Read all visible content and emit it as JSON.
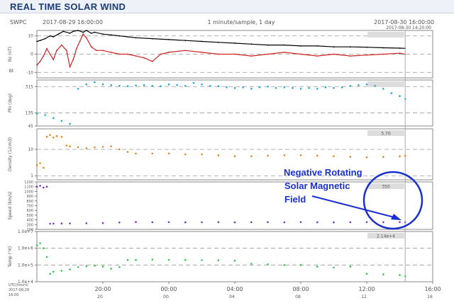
{
  "page": {
    "title": "REAL TIME SOLAR WIND"
  },
  "header": {
    "source": "SWPC",
    "start": "2017-08-29 16:00:00",
    "cadence": "1 minute/sample, 1 day",
    "end": "2017-08-30 16:00:00"
  },
  "cursor": {
    "time": "2017-08-30 14:20:00"
  },
  "annotation": {
    "lines": [
      "Negative Rotating",
      "Solar Magnetic",
      "Field"
    ],
    "color": "#1a2fd0"
  },
  "time_axis": {
    "label": "UTC(hours)",
    "date_label": "2017-08-29",
    "date_label2": "16:00",
    "ticks": [
      "20:00",
      "00:00",
      "04:00",
      "08:00",
      "12:00",
      "16:00"
    ],
    "tick_hours": [
      4,
      8,
      12,
      16,
      20,
      24
    ],
    "minor_ticks": [
      "20",
      "00",
      "04",
      "08",
      "12",
      "16"
    ],
    "range_hours": [
      0,
      24
    ],
    "cursor_hour": 22.33
  },
  "chart_data": [
    {
      "type": "line",
      "ylabel": "Bz (nT)",
      "ylabel2": "Bt",
      "yticks": [
        "10",
        "0",
        "-10"
      ],
      "ytick_values": [
        10,
        0,
        -10
      ],
      "ylim": [
        -13,
        13
      ],
      "cursor_readout": "",
      "grid": "dashed at 10, 0, -10",
      "series": [
        {
          "color": "#000000",
          "x": [
            0,
            0.2,
            0.5,
            0.8,
            1,
            1.3,
            1.6,
            2,
            2.2,
            2.5,
            2.8,
            3,
            3.3,
            3.5,
            4,
            4.5,
            5,
            5.5,
            6,
            7,
            8,
            9,
            10,
            11,
            12,
            13,
            14,
            15,
            16,
            17,
            18,
            19,
            20,
            21,
            22,
            22.33
          ],
          "y": [
            7,
            7.5,
            8.5,
            10,
            9.5,
            11,
            12.5,
            11.5,
            12.5,
            13,
            12,
            13,
            11.5,
            12,
            11,
            10.5,
            10,
            9.5,
            9,
            8.5,
            8,
            7.5,
            7,
            6.5,
            6,
            5.5,
            5,
            5,
            4.5,
            4.5,
            4,
            4,
            3.8,
            3.5,
            3.3,
            3.2
          ]
        },
        {
          "color": "#d02020",
          "x": [
            0,
            0.2,
            0.4,
            0.6,
            0.8,
            1,
            1.2,
            1.5,
            1.8,
            2,
            2.2,
            2.4,
            2.6,
            2.8,
            3,
            3.3,
            3.6,
            4,
            4.5,
            5,
            5.5,
            6,
            6.5,
            7,
            7.5,
            8,
            9,
            10,
            11,
            12,
            13,
            14,
            15,
            16,
            17,
            18,
            19,
            20,
            21,
            22,
            22.33
          ],
          "y": [
            -6,
            -4,
            -1,
            3,
            0,
            -3,
            2,
            5,
            2,
            -7,
            -3,
            3,
            7,
            11,
            9,
            4,
            2,
            2,
            1,
            0,
            0,
            -1,
            -2,
            -4,
            0,
            1,
            2,
            1,
            0,
            0,
            -1,
            0,
            1,
            0,
            -1,
            0,
            -1,
            -0.5,
            0,
            0.5,
            0
          ]
        }
      ]
    },
    {
      "type": "scatter",
      "ylabel": "Phi (deg)",
      "yticks": [
        "315",
        "135",
        "45"
      ],
      "ytick_values": [
        315,
        135,
        45
      ],
      "ylim": [
        45,
        360
      ],
      "cursor_readout": "",
      "grid": "dashed at 315, 135",
      "series": [
        {
          "color": "#20a8d8",
          "x": [
            0,
            0.5,
            1,
            1.5,
            2,
            2.5,
            3,
            3.5,
            4,
            4.5,
            5,
            5.5,
            6,
            6.5,
            7,
            7.5,
            8,
            8.5,
            9,
            9.5,
            10,
            10.5,
            11,
            11.5,
            12,
            12.5,
            13,
            13.5,
            14,
            14.5,
            15,
            15.5,
            16,
            16.5,
            17,
            17.5,
            18,
            18.5,
            19,
            19.5,
            20,
            20.5,
            21,
            21.5,
            22,
            22.33
          ],
          "y": [
            130,
            120,
            100,
            80,
            60,
            300,
            330,
            345,
            330,
            325,
            320,
            318,
            322,
            325,
            320,
            318,
            330,
            325,
            320,
            340,
            330,
            320,
            318,
            310,
            305,
            310,
            300,
            310,
            315,
            305,
            310,
            305,
            300,
            305,
            300,
            310,
            305,
            310,
            320,
            325,
            330,
            320,
            300,
            270,
            250,
            230
          ]
        }
      ]
    },
    {
      "type": "scatter",
      "ylabel": "Density (1/cm3)",
      "yticks": [
        "10",
        "1"
      ],
      "ytick_values": [
        10,
        1
      ],
      "ylim": [
        0.7,
        60
      ],
      "log_scale": true,
      "cursor_readout": "5.70",
      "grid": "dashed at 10, 1",
      "series": [
        {
          "color": "#e88420",
          "x": [
            0,
            0.2,
            0.4,
            0.6,
            0.8,
            1,
            1.2,
            1.5,
            1.8,
            2,
            2.5,
            3,
            3.5,
            4,
            4.5,
            5,
            5.5,
            6,
            7,
            8,
            9,
            10,
            11,
            12,
            13,
            14,
            15,
            16,
            17,
            18,
            19,
            20,
            21,
            22,
            22.33
          ],
          "y": [
            2.5,
            3,
            2,
            30,
            35,
            28,
            32,
            30,
            14,
            13,
            12,
            11,
            12,
            12.5,
            13,
            10,
            8,
            7,
            7,
            7,
            6.5,
            6.5,
            6,
            5.5,
            5.5,
            5.8,
            6,
            6,
            5.8,
            5.5,
            5.2,
            5,
            5.2,
            5.5,
            5.7
          ]
        }
      ]
    },
    {
      "type": "scatter",
      "ylabel": "Speed (km/s)",
      "yticks": [
        "1200",
        "1100",
        "1000",
        "900",
        "800",
        "700",
        "600",
        "500",
        "400",
        "300",
        "200"
      ],
      "ytick_values": [
        1200,
        1100,
        1000,
        900,
        800,
        700,
        600,
        500,
        400,
        300,
        200
      ],
      "ylim": [
        200,
        1200
      ],
      "cursor_readout": "350",
      "grid": "none",
      "series": [
        {
          "color": "#8030c0",
          "x": [
            0,
            0.2,
            0.4,
            0.6,
            0.8,
            1,
            1.5,
            2,
            3,
            4,
            5,
            6,
            7,
            8,
            9,
            10,
            11,
            12,
            13,
            14,
            15,
            16,
            17,
            18,
            19,
            20,
            21,
            22,
            22.33
          ],
          "y": [
            1100,
            1120,
            1080,
            1100,
            320,
            322,
            325,
            327,
            330,
            333,
            345,
            355,
            350,
            352,
            348,
            350,
            352,
            348,
            350,
            352,
            350,
            352,
            350,
            348,
            350,
            352,
            350,
            352,
            350
          ]
        }
      ]
    },
    {
      "type": "scatter",
      "ylabel": "Temp (°K)",
      "yticks": [
        "1.0e+7",
        "1.0e+6",
        "1.0e+5",
        "1.0e+4"
      ],
      "ytick_values": [
        10000000,
        1000000,
        100000,
        10000
      ],
      "ylim": [
        10000,
        10000000
      ],
      "log_scale": true,
      "cursor_readout": "2.14e+4",
      "grid": "dashed at 1.0e+6, 1.0e+5",
      "series": [
        {
          "color": "#30c840",
          "x": [
            0,
            0.2,
            0.4,
            0.6,
            0.8,
            1,
            1.5,
            2,
            2.5,
            3,
            3.5,
            4,
            4.5,
            5,
            5.5,
            6,
            7,
            8,
            9,
            10,
            11,
            12,
            13,
            14,
            15,
            16,
            17,
            18,
            19,
            20,
            21,
            22,
            22.33
          ],
          "y": [
            1500000,
            2000000,
            1000000,
            300000,
            30000,
            40000,
            45000,
            55000,
            75000,
            85000,
            90000,
            80000,
            60000,
            75000,
            200000,
            200000,
            210000,
            205000,
            200000,
            195000,
            190000,
            180000,
            120000,
            110000,
            100000,
            100000,
            80000,
            70000,
            80000,
            30000,
            28000,
            25000,
            21400
          ]
        }
      ]
    }
  ]
}
